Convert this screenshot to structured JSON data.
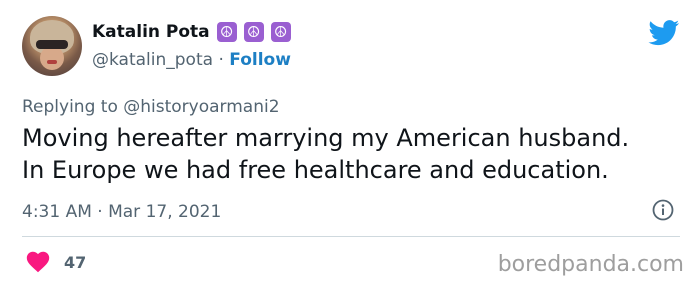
{
  "author": {
    "display_name": "Katalin Pota",
    "badges": [
      "☮",
      "☮",
      "☮"
    ],
    "handle": "@katalin_pota",
    "separator": "·",
    "follow_label": "Follow"
  },
  "reply": {
    "prefix": "Replying to",
    "mention": "@historyoarmani2"
  },
  "tweet": {
    "line1": "Moving hereafter marrying my American husband.",
    "line2": "In Europe we had free healthcare and education."
  },
  "meta": {
    "timestamp": "4:31 AM · Mar 17, 2021"
  },
  "engagement": {
    "like_count": "47"
  },
  "watermark": "boredpanda.com",
  "icons": {
    "brand": "twitter-bird-icon",
    "info": "info-icon",
    "like": "heart-icon"
  },
  "colors": {
    "twitter_blue": "#1d9bf0",
    "follow_blue": "#1d7fc4",
    "heart_pink": "#f91880",
    "badge_purple": "#9a5fd1",
    "muted_text": "#536471"
  }
}
